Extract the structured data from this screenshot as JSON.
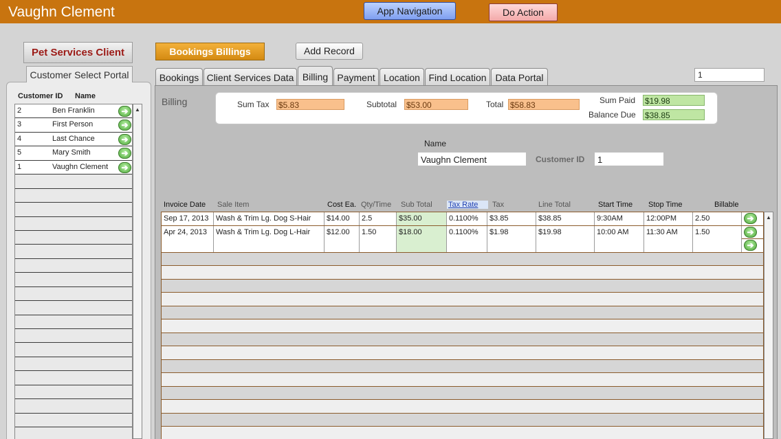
{
  "header": {
    "title": "Vaughn Clement",
    "nav_button": "App Navigation",
    "action_button": "Do Action"
  },
  "left": {
    "pet_services_button": "Pet Services Client",
    "portal_label": "Customer Select Portal",
    "col_customer_id": "Customer ID",
    "col_name": "Name",
    "customers": [
      {
        "id": "2",
        "name": "Ben Franklin"
      },
      {
        "id": "3",
        "name": "First Person"
      },
      {
        "id": "4",
        "name": "Last Chance"
      },
      {
        "id": "5",
        "name": "Mary Smith"
      },
      {
        "id": "1",
        "name": "Vaughn Clement"
      }
    ]
  },
  "toolbar": {
    "bookings_billings": "Bookings Billings",
    "add_record": "Add Record",
    "record_field": "1"
  },
  "tabs": [
    {
      "label": "Bookings"
    },
    {
      "label": "Client Services Data"
    },
    {
      "label": "Billing"
    },
    {
      "label": "Payment"
    },
    {
      "label": "Location"
    },
    {
      "label": "Find Location"
    },
    {
      "label": "Data Portal"
    }
  ],
  "billing": {
    "section_label": "Billing",
    "sum_tax_label": "Sum Tax",
    "sum_tax": "$5.83",
    "subtotal_label": "Subtotal",
    "subtotal": "$53.00",
    "total_label": "Total",
    "total": "$58.83",
    "sum_paid_label": "Sum Paid",
    "sum_paid": "$19.98",
    "balance_due_label": "Balance Due",
    "balance_due": "$38.85",
    "name_label": "Name",
    "name": "Vaughn Clement",
    "customer_id_label": "Customer ID",
    "customer_id": "1"
  },
  "lines": {
    "headers": {
      "invoice_date": "Invoice Date",
      "sale_item": "Sale Item",
      "cost_ea": "Cost Ea.",
      "qty_time": "Qty/Time",
      "sub_total": "Sub Total",
      "tax_rate": "Tax Rate",
      "tax": "Tax",
      "line_total": "Line Total",
      "start_time": "Start Time",
      "stop_time": "Stop Time",
      "billable": "Billable"
    },
    "rows": [
      {
        "invoice_date": "Sep 17, 2013",
        "sale_item": "Wash & Trim Lg. Dog S-Hair",
        "cost_ea": "$14.00",
        "qty": "2.5",
        "sub_total": "$35.00",
        "tax_rate": "0.1100%",
        "tax": "$3.85",
        "line_total": "$38.85",
        "start": "9:30AM",
        "stop": "12:00PM",
        "billable": "2.50"
      },
      {
        "invoice_date": "Apr 24, 2013",
        "sale_item": "Wash & Trim Lg. Dog L-Hair",
        "cost_ea": "$12.00",
        "qty": "1.50",
        "sub_total": "$18.00",
        "tax_rate": "0.1100%",
        "tax": "$1.98",
        "line_total": "$19.98",
        "start": "10:00 AM",
        "stop": "11:30 AM",
        "billable": "1.50"
      }
    ]
  },
  "icons": {
    "go": "go-arrow-icon",
    "scroll_up": "scroll-up-icon"
  }
}
